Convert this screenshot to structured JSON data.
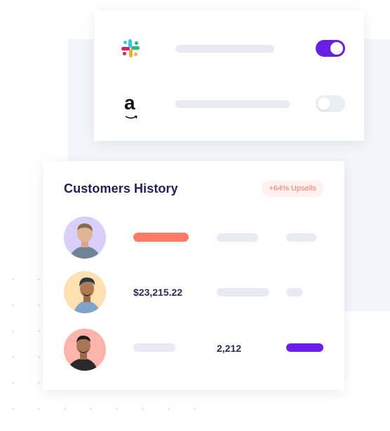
{
  "integrations": {
    "items": [
      {
        "app": "Slack",
        "icon": "slack-logo-icon",
        "enabled": true
      },
      {
        "app": "Amazon",
        "icon": "amazon-logo-icon",
        "logo_text": "a",
        "enabled": false
      }
    ]
  },
  "customers": {
    "title": "Customers History",
    "badge": "+64% Upsells",
    "rows": [
      {
        "avatar": "person-1",
        "value": "",
        "count": ""
      },
      {
        "avatar": "person-2",
        "value": "$23,215.22",
        "count": ""
      },
      {
        "avatar": "person-3",
        "value": "",
        "count": "2,212"
      }
    ]
  },
  "colors": {
    "accent": "#6a1fe6",
    "salmon": "#ff7b68",
    "title": "#1f1f5c",
    "placeholder": "#e9e9f3"
  }
}
